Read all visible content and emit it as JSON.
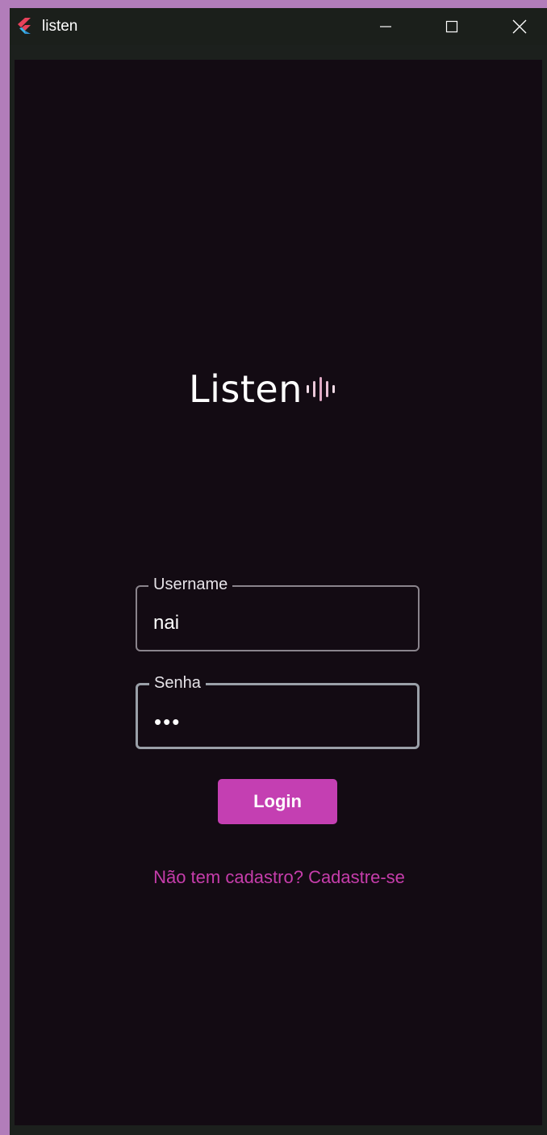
{
  "window": {
    "title": "listen",
    "icons": {
      "app": "flutter-icon",
      "minimize": "minimize-icon",
      "maximize": "maximize-icon",
      "close": "close-icon"
    }
  },
  "logo": {
    "text": "Listen",
    "icon": "sound-wave-icon"
  },
  "form": {
    "username": {
      "label": "Username",
      "value": "nai"
    },
    "password": {
      "label": "Senha",
      "value": "•••"
    },
    "login_label": "Login",
    "signup_link": "Não tem cadastro? Cadastre-se"
  },
  "colors": {
    "accent": "#c43fb2",
    "link": "#c63dab",
    "background": "#130b13",
    "titlebar": "#1b1f1b"
  }
}
